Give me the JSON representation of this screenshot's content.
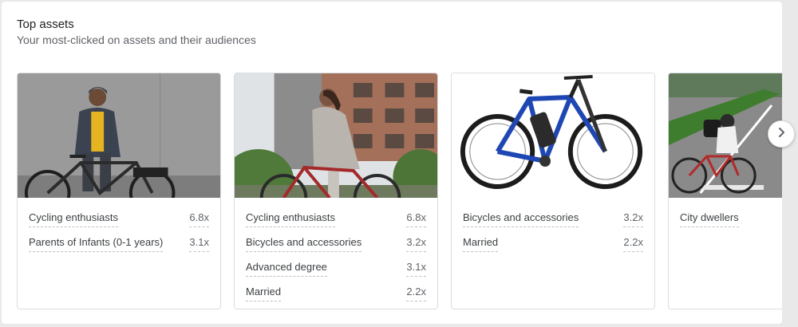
{
  "header": {
    "title": "Top assets",
    "subtitle": "Your most-clicked on assets and their audiences"
  },
  "cards": [
    {
      "image": "man-with-e-bike-photo",
      "audiences": [
        {
          "label": "Cycling enthusiasts",
          "value": "6.8x"
        },
        {
          "label": "Parents of Infants (0-1 years)",
          "value": "3.1x"
        }
      ]
    },
    {
      "image": "woman-riding-bike-photo",
      "audiences": [
        {
          "label": "Cycling enthusiasts",
          "value": "6.8x"
        },
        {
          "label": "Bicycles and accessories",
          "value": "3.2x"
        },
        {
          "label": "Advanced degree",
          "value": "3.1x"
        },
        {
          "label": "Married",
          "value": "2.2x"
        }
      ]
    },
    {
      "image": "blue-e-mountain-bike-photo",
      "audiences": [
        {
          "label": "Bicycles and accessories",
          "value": "3.2x"
        },
        {
          "label": "Married",
          "value": "2.2x"
        }
      ]
    },
    {
      "image": "city-cyclist-photo",
      "audiences": [
        {
          "label": "City dwellers",
          "value": ""
        }
      ]
    }
  ],
  "navigation": {
    "next_icon": "chevron-right-icon"
  }
}
